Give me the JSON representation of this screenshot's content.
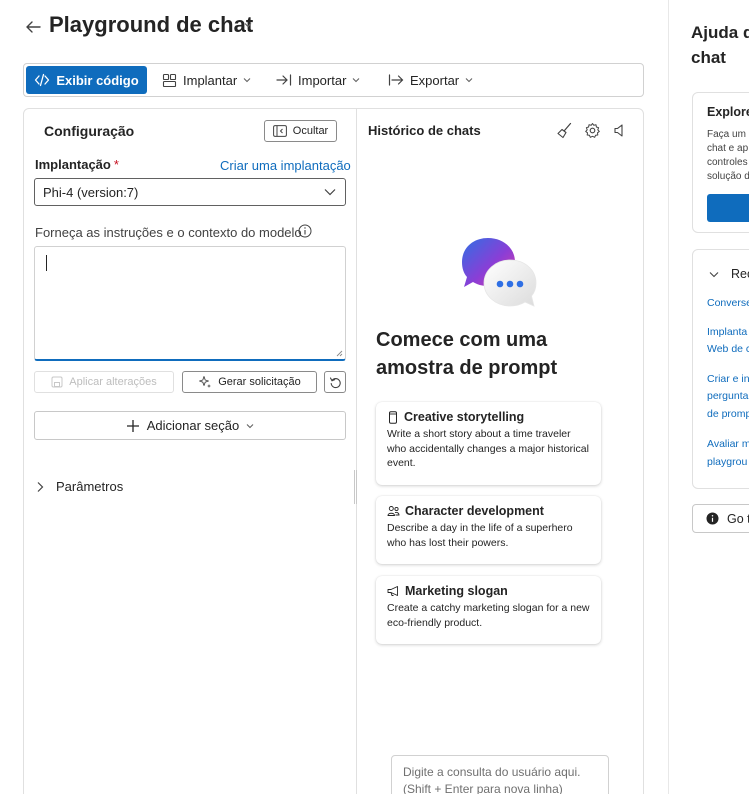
{
  "header": {
    "title": "Playground de chat"
  },
  "toolbar": {
    "view_code": "Exibir código",
    "deploy": "Implantar",
    "import": "Importar",
    "export": "Exportar"
  },
  "config": {
    "title": "Configuração",
    "hide": "Ocultar",
    "deployment_label": "Implantação",
    "required_mark": "*",
    "create_deployment": "Criar uma implantação",
    "selected_deployment": "Phi-4 (version:7)",
    "instructions_label": "Forneça as instruções e o contexto do modelo",
    "apply_changes": "Aplicar alterações",
    "generate_prompt": "Gerar solicitação",
    "add_section": "Adicionar seção",
    "parameters": "Parâmetros"
  },
  "history": {
    "title": "Histórico de chats",
    "start_heading": "Comece com uma amostra de prompt",
    "cards": [
      {
        "title": "Creative storytelling",
        "desc": "Write a short story about a time traveler who accidentally changes a major historical event.",
        "icon": "mobile-icon"
      },
      {
        "title": "Character development",
        "desc": "Describe a day in the life of a superhero who has lost their powers.",
        "icon": "people-icon"
      },
      {
        "title": "Marketing slogan",
        "desc": "Create a catchy marketing slogan for a new eco-friendly product.",
        "icon": "megaphone-icon"
      }
    ],
    "query_placeholder_line1": "Digite a consulta do usuário aqui.",
    "query_placeholder_line2": "(Shift + Enter para nova linha)"
  },
  "help": {
    "title_line1": "Ajuda d",
    "title_line2": "chat",
    "card1_title": "Explore",
    "card1_lines": [
      "Faça um",
      "chat e ap",
      "controles",
      "solução d"
    ],
    "card2_head": "Rec",
    "links": [
      "Converse",
      "Implanta",
      "Web de c",
      "Criar e in",
      "pergunta",
      "de promp",
      "Avaliar m",
      "playgrou"
    ],
    "go_button": "Go t"
  },
  "colors": {
    "accent": "#0f6cbd",
    "required": "#c50f1f"
  }
}
